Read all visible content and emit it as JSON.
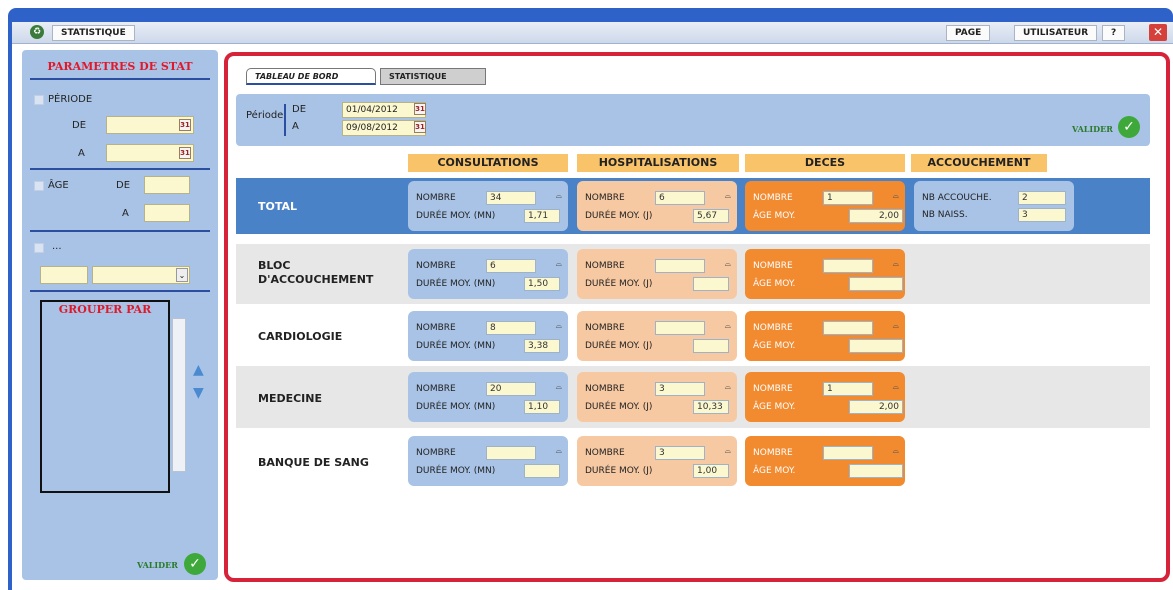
{
  "titlebar": {
    "title": "STATISTIQUE",
    "menu": [
      "PAGE",
      "UTILISATEUR",
      "?"
    ],
    "close": "✕"
  },
  "left": {
    "title": "PARAMETRES DE STAT",
    "periode": "PÉRIODE",
    "de": "DE",
    "a": "A",
    "age": "ÂGE",
    "age_de": "DE",
    "age_a": "A",
    "more": "...",
    "group_by": "GROUPER PAR",
    "valider": "VALIDER"
  },
  "tabs": [
    "TABLEAU DE BORD",
    "STATISTIQUE"
  ],
  "period": {
    "label": "Période",
    "de_label": "DE",
    "a_label": "A",
    "de_value": "01/04/2012",
    "a_value": "09/08/2012",
    "valider": "VALIDER"
  },
  "columns": [
    "CONSULTATIONS",
    "HOSPITALISATIONS",
    "DECES",
    "ACCOUCHEMENT"
  ],
  "rows": [
    {
      "label": "TOTAL",
      "cons": {
        "nombre_label": "NOMBRE",
        "nombre": "34",
        "duree_label": "DURÉE MOY. (MN)",
        "duree": "1,71"
      },
      "hosp": {
        "nombre_label": "NOMBRE",
        "nombre": "6",
        "duree_label": "DURÉE MOY. (J)",
        "duree": "5,67"
      },
      "deces": {
        "nombre_label": "NOMBRE",
        "nombre": "1",
        "age_label": "ÂGE MOY.",
        "age": "2,00"
      },
      "acc": {
        "nb_acc_label": "NB ACCOUCHE.",
        "nb_acc": "2",
        "nb_naiss_label": "NB NAISS.",
        "nb_naiss": "3"
      }
    },
    {
      "label": "BLOC D'ACCOUCHEMENT",
      "cons": {
        "nombre_label": "NOMBRE",
        "nombre": "6",
        "duree_label": "DURÉE MOY. (MN)",
        "duree": "1,50"
      },
      "hosp": {
        "nombre_label": "NOMBRE",
        "nombre": "",
        "duree_label": "DURÉE MOY. (J)",
        "duree": ""
      },
      "deces": {
        "nombre_label": "NOMBRE",
        "nombre": "",
        "age_label": "ÂGE MOY.",
        "age": ""
      }
    },
    {
      "label": "CARDIOLOGIE",
      "cons": {
        "nombre_label": "NOMBRE",
        "nombre": "8",
        "duree_label": "DURÉE MOY. (MN)",
        "duree": "3,38"
      },
      "hosp": {
        "nombre_label": "NOMBRE",
        "nombre": "",
        "duree_label": "DURÉE MOY. (J)",
        "duree": ""
      },
      "deces": {
        "nombre_label": "NOMBRE",
        "nombre": "",
        "age_label": "ÂGE MOY.",
        "age": ""
      }
    },
    {
      "label": "MEDECINE",
      "cons": {
        "nombre_label": "NOMBRE",
        "nombre": "20",
        "duree_label": "DURÉE MOY. (MN)",
        "duree": "1,10"
      },
      "hosp": {
        "nombre_label": "NOMBRE",
        "nombre": "3",
        "duree_label": "DURÉE MOY. (J)",
        "duree": "10,33"
      },
      "deces": {
        "nombre_label": "NOMBRE",
        "nombre": "1",
        "age_label": "ÂGE MOY.",
        "age": "2,00"
      }
    },
    {
      "label": "BANQUE DE SANG",
      "cons": {
        "nombre_label": "NOMBRE",
        "nombre": "",
        "duree_label": "DURÉE MOY. (MN)",
        "duree": ""
      },
      "hosp": {
        "nombre_label": "NOMBRE",
        "nombre": "3",
        "duree_label": "DURÉE MOY. (J)",
        "duree": "1,00"
      },
      "deces": {
        "nombre_label": "NOMBRE",
        "nombre": "",
        "age_label": "ÂGE MOY.",
        "age": ""
      }
    }
  ]
}
